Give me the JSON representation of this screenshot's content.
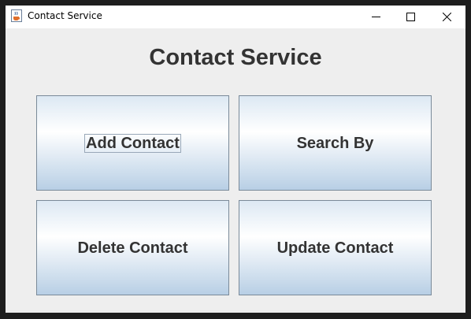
{
  "window": {
    "title": "Contact Service",
    "icon": "java-cup-icon",
    "controls": [
      "minimize-icon",
      "maximize-icon",
      "close-icon"
    ]
  },
  "main": {
    "heading": "Contact Service",
    "buttons": [
      {
        "label": "Add Contact",
        "focused": true
      },
      {
        "label": "Search By",
        "focused": false
      },
      {
        "label": "Delete Contact",
        "focused": false
      },
      {
        "label": "Update Contact",
        "focused": false
      }
    ]
  },
  "colors": {
    "window_background": "#eeeeee",
    "button_gradient_top": "#dce8f3",
    "button_gradient_mid": "#ffffff",
    "button_gradient_bottom": "#b8cfe5",
    "text": "#333333"
  }
}
